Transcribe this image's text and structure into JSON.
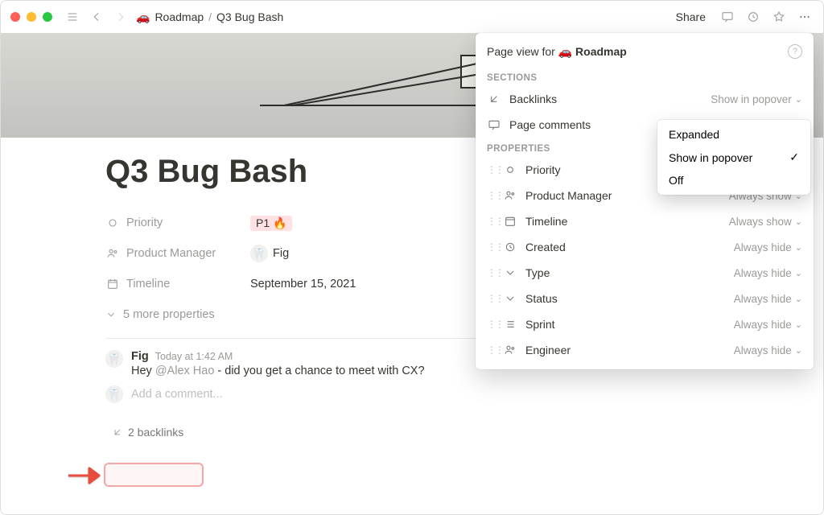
{
  "topbar": {
    "breadcrumb_emoji": "🚗",
    "breadcrumb_parent": "Roadmap",
    "breadcrumb_sep": "/",
    "breadcrumb_current": "Q3 Bug Bash",
    "share": "Share"
  },
  "page": {
    "title": "Q3 Bug Bash",
    "properties": [
      {
        "key": "Priority",
        "value": "P1 🔥",
        "tag": true
      },
      {
        "key": "Product Manager",
        "value": "Fig",
        "avatar": "🦷"
      },
      {
        "key": "Timeline",
        "value": "September 15, 2021"
      }
    ],
    "more_properties": "5 more properties",
    "comment": {
      "avatar": "🦷",
      "author": "Fig",
      "time": "Today at 1:42 AM",
      "body_pre": "Hey ",
      "mention": "@Alex Hao",
      "body_post": " - did you get a chance to meet with CX?",
      "add_placeholder": "Add a comment..."
    },
    "backlinks_label": "2 backlinks"
  },
  "panel": {
    "title_pre": "Page view for ",
    "title_emoji": "🚗",
    "title_name": "Roadmap",
    "section_label_1": "SECTIONS",
    "section_label_2": "PROPERTIES",
    "sections": [
      {
        "label": "Backlinks",
        "trail": "Show in popover"
      },
      {
        "label": "Page comments",
        "trail": ""
      }
    ],
    "properties": [
      {
        "label": "Priority",
        "trail": ""
      },
      {
        "label": "Product Manager",
        "trail": "Always show"
      },
      {
        "label": "Timeline",
        "trail": "Always show"
      },
      {
        "label": "Created",
        "trail": "Always hide"
      },
      {
        "label": "Type",
        "trail": "Always hide"
      },
      {
        "label": "Status",
        "trail": "Always hide"
      },
      {
        "label": "Sprint",
        "trail": "Always hide"
      },
      {
        "label": "Engineer",
        "trail": "Always hide"
      }
    ]
  },
  "menu": {
    "items": [
      {
        "label": "Expanded",
        "checked": false
      },
      {
        "label": "Show in popover",
        "checked": true
      },
      {
        "label": "Off",
        "checked": false
      }
    ]
  }
}
